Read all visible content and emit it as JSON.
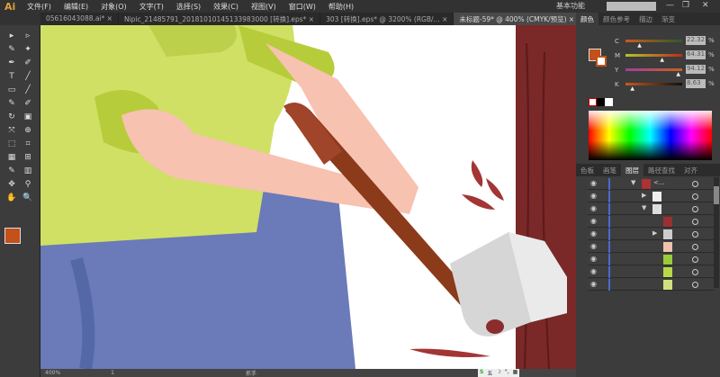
{
  "app": {
    "logo": "Ai",
    "workspace": "基本功能",
    "window_buttons": [
      "—",
      "❐",
      "✕"
    ]
  },
  "menu": [
    "文件(F)",
    "编辑(E)",
    "对象(O)",
    "文字(T)",
    "选择(S)",
    "效果(C)",
    "视图(V)",
    "窗口(W)",
    "帮助(H)"
  ],
  "tabs": [
    {
      "label": "05616043088.ai* ×",
      "active": false
    },
    {
      "label": "Nipic_21485791_20181010145133983000 [转换].eps* ×",
      "active": false
    },
    {
      "label": "303 [转换].eps* @ 3200% (RGB/... ×",
      "active": false
    },
    {
      "label": "未标题-59* @ 400% (CMYK/预览) ×",
      "active": true
    }
  ],
  "tabs_overflow": ">>",
  "tools": [
    "▸",
    "▹",
    "✎",
    "✦",
    "✒",
    "✐",
    "T",
    "╱",
    "▭",
    "╱",
    "✎",
    "✐",
    "↻",
    "▣",
    "⤧",
    "⊕",
    "⬚",
    "⌗",
    "▦",
    "⊞",
    "✎",
    "▥",
    "✥",
    "⚲",
    "✋",
    "🔍"
  ],
  "color_panel": {
    "tabs": [
      "颜色",
      "颜色参考",
      "描边",
      "渐变"
    ],
    "fill_color": "#c4501a",
    "channels": [
      {
        "label": "C",
        "value": "22.32",
        "pct": "%",
        "fraction": 0.22,
        "gradient": "linear-gradient(90deg,#c85a1c,#2d5a2a)"
      },
      {
        "label": "M",
        "value": "64.31",
        "pct": "%",
        "fraction": 0.64,
        "gradient": "linear-gradient(90deg,#b0c82a,#c02a1a)"
      },
      {
        "label": "Y",
        "value": "94.12",
        "pct": "%",
        "fraction": 0.94,
        "gradient": "linear-gradient(90deg,#a040a0,#c8601c)"
      },
      {
        "label": "K",
        "value": "8.63",
        "pct": "%",
        "fraction": 0.09,
        "gradient": "linear-gradient(90deg,#c85a1c,#111)"
      }
    ]
  },
  "layers_panel": {
    "tabs": [
      "色板",
      "画笔",
      "图层",
      "路径查找",
      "对齐"
    ],
    "rows": [
      {
        "name": "<...",
        "expand": "▼",
        "indent": 0,
        "thumb": "#a33"
      },
      {
        "name": "",
        "expand": "▶",
        "indent": 1,
        "thumb": "#eee"
      },
      {
        "name": "",
        "expand": "▼",
        "indent": 1,
        "thumb": "#ddd"
      },
      {
        "name": "",
        "expand": "",
        "indent": 2,
        "thumb": "#9b3030"
      },
      {
        "name": "",
        "expand": "▶",
        "indent": 2,
        "thumb": "#ccc"
      },
      {
        "name": "",
        "expand": "",
        "indent": 2,
        "thumb": "#f0c0b0"
      },
      {
        "name": "",
        "expand": "",
        "indent": 2,
        "thumb": "#9acb3a"
      },
      {
        "name": "",
        "expand": "",
        "indent": 2,
        "thumb": "#b8d84a"
      },
      {
        "name": "",
        "expand": "",
        "indent": 2,
        "thumb": "#d0e080"
      }
    ]
  },
  "status": {
    "zoom": "400%",
    "page": "1",
    "tool": "抓手"
  },
  "ime": {
    "labels": [
      "S",
      "五",
      "☽",
      "°,",
      "▦"
    ]
  }
}
